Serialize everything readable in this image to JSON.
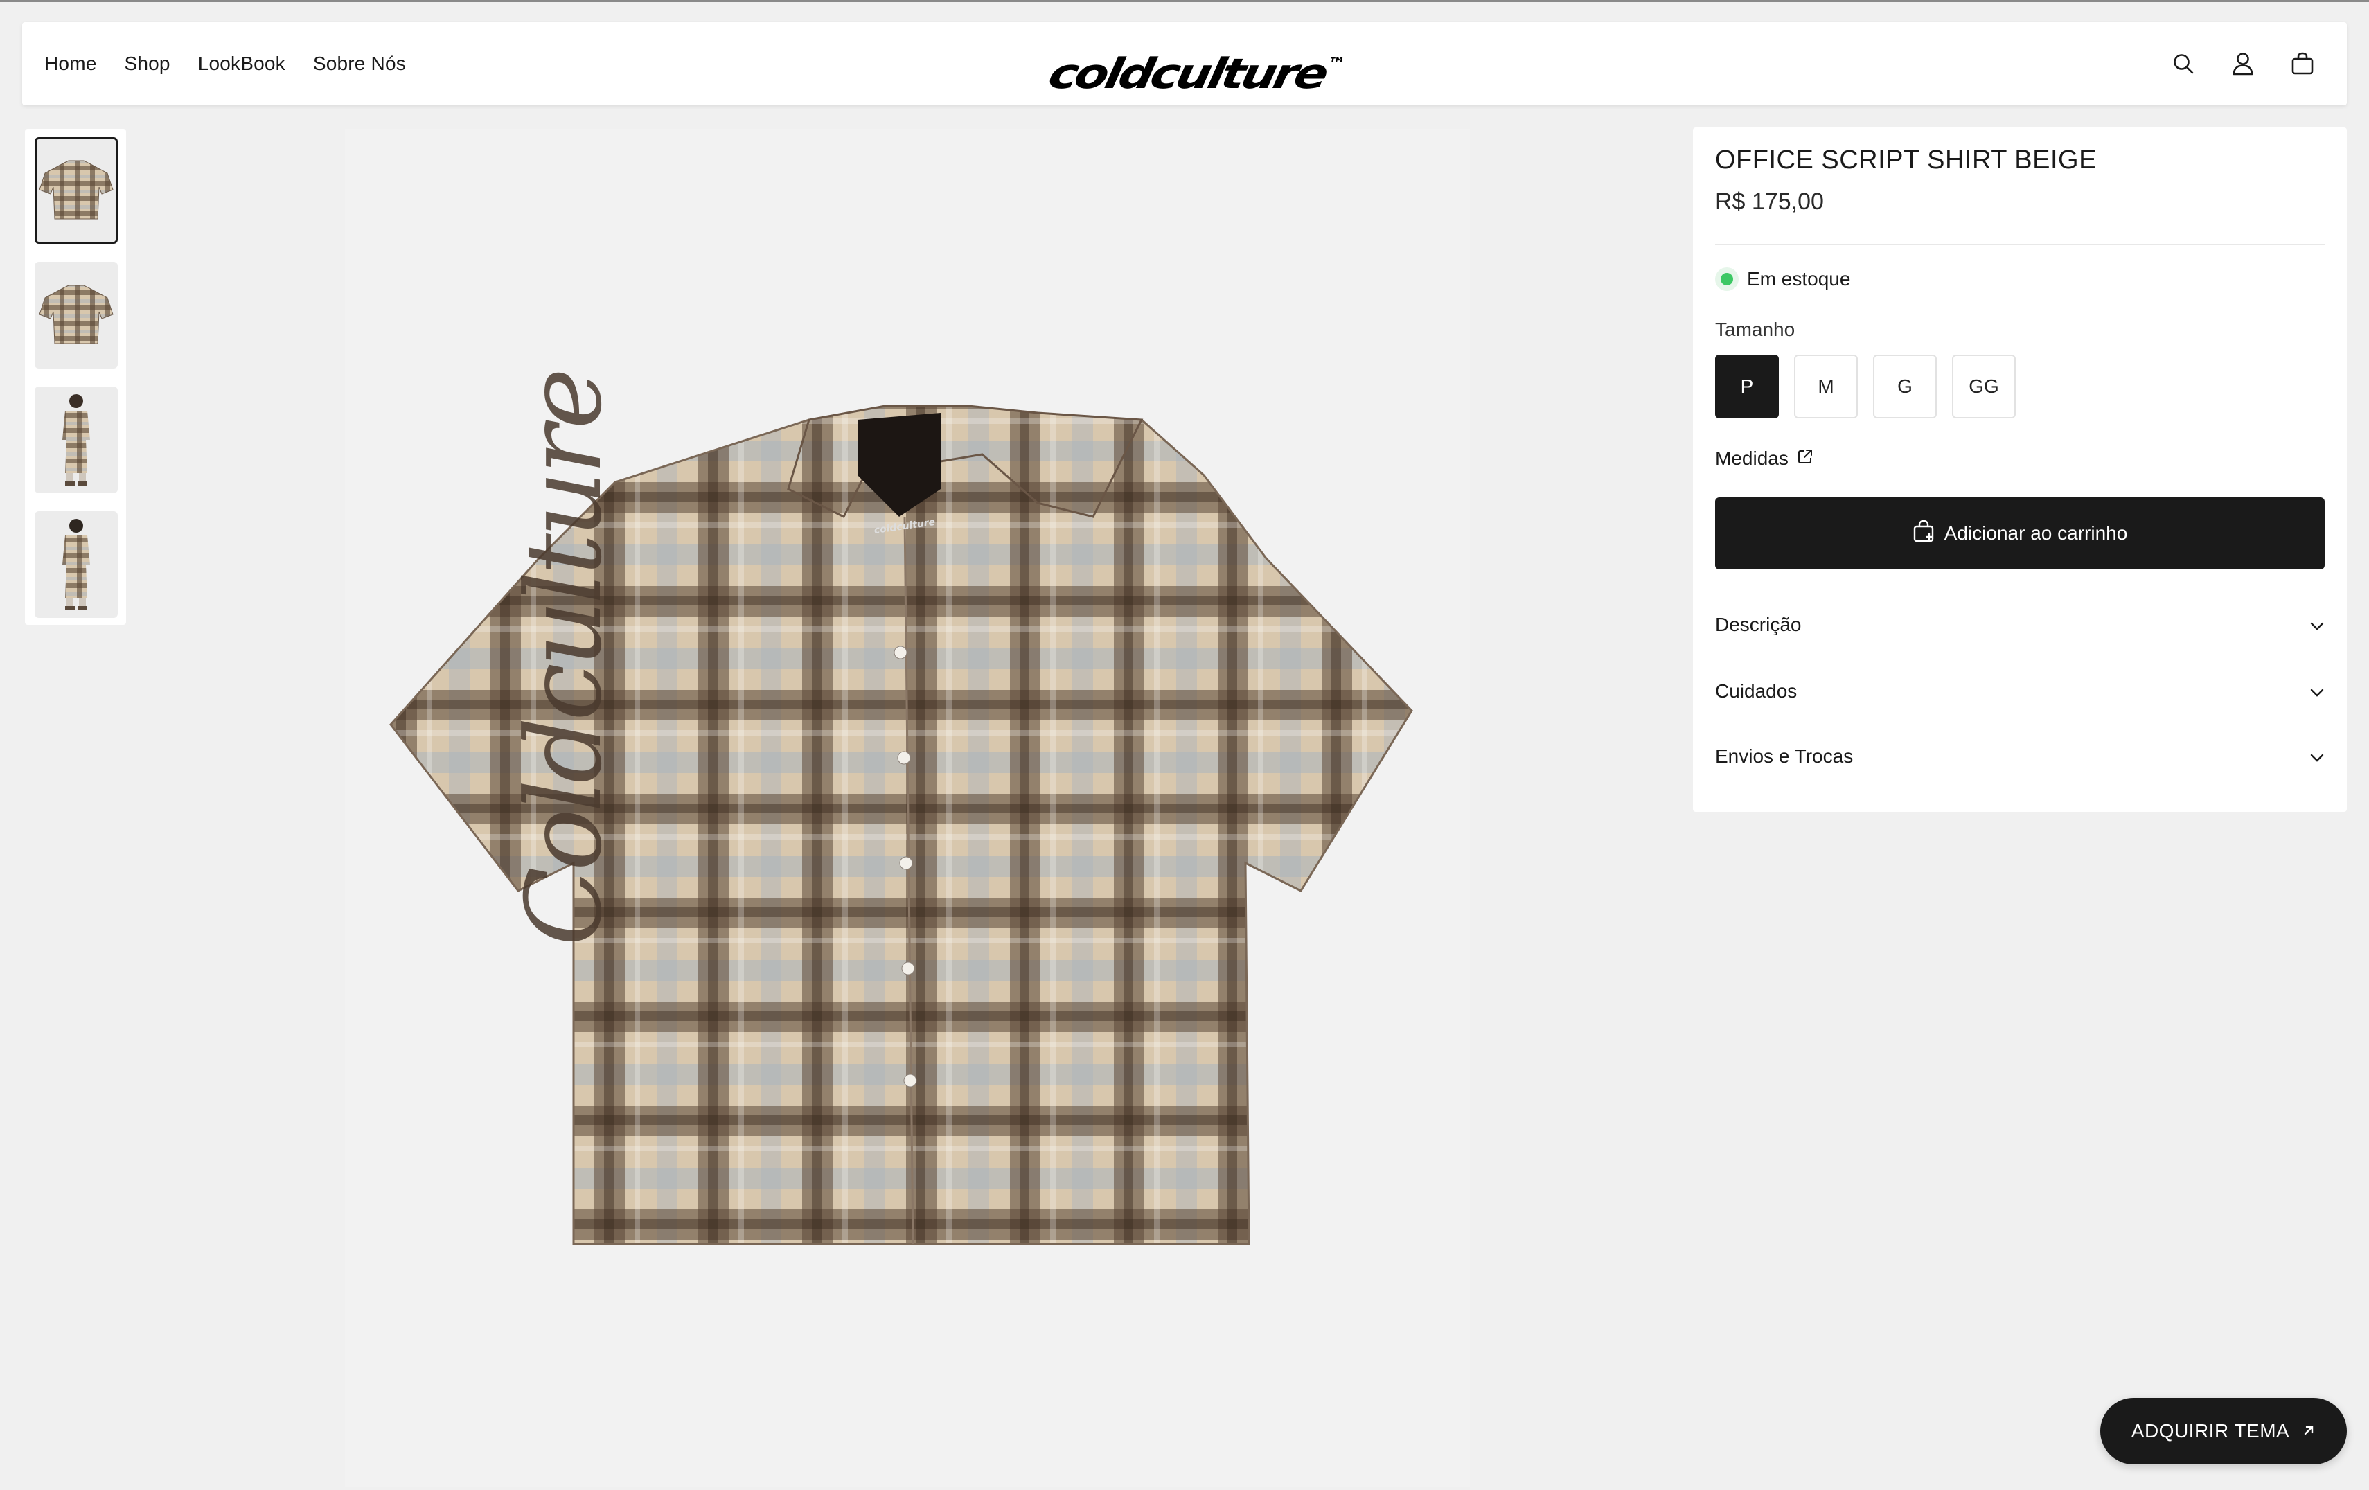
{
  "header": {
    "nav": [
      {
        "label": "Home"
      },
      {
        "label": "Shop"
      },
      {
        "label": "LookBook"
      },
      {
        "label": "Sobre Nós"
      }
    ],
    "logo_text": "coldculture",
    "logo_tm": "™",
    "icons": [
      "search-icon",
      "account-icon",
      "cart-bag-icon"
    ]
  },
  "gallery": {
    "thumbnails": [
      "shirt-front",
      "shirt-back",
      "model-front",
      "model-back"
    ],
    "active_index": 0,
    "print_text": "Coldculture",
    "label_text": "coldculture"
  },
  "product": {
    "title": "OFFICE SCRIPT SHIRT BEIGE",
    "price": "R$ 175,00",
    "stock_status": "Em estoque",
    "stock_color": "#3cc864",
    "size_label": "Tamanho",
    "sizes": [
      "P",
      "M",
      "G",
      "GG"
    ],
    "selected_size": "P",
    "measurements_label": "Medidas",
    "add_to_cart_label": "Adicionar ao carrinho",
    "accordions": [
      {
        "label": "Descrição"
      },
      {
        "label": "Cuidados"
      },
      {
        "label": "Envios e Trocas"
      }
    ]
  },
  "cta": {
    "label": "ADQUIRIR TEMA"
  },
  "colors": {
    "background": "#f0f0f0",
    "primary": "#1a1a1a",
    "panel": "#ffffff",
    "plaid_base": "#d9c8b0",
    "plaid_dark": "#5a4636",
    "plaid_blue": "#aab4bd"
  }
}
